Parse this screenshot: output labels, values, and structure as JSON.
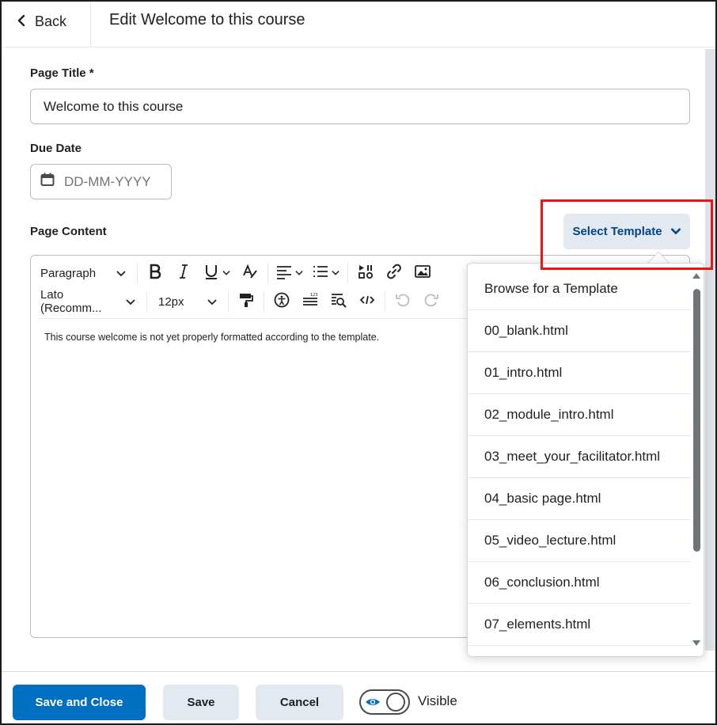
{
  "header": {
    "back_label": "Back",
    "title": "Edit Welcome to this course"
  },
  "form": {
    "page_title_label": "Page Title *",
    "page_title_value": "Welcome to this course",
    "due_date_label": "Due Date",
    "due_date_placeholder": "DD-MM-YYYY",
    "page_content_label": "Page Content"
  },
  "select_template": {
    "label": "Select Template"
  },
  "toolbar": {
    "block_format": "Paragraph",
    "font_family": "Lato (Recomm...",
    "font_size": "12px"
  },
  "editor": {
    "content": "This course welcome is not yet properly formatted according to the template."
  },
  "template_dropdown": {
    "items": [
      "Browse for a Template",
      "00_blank.html",
      "01_intro.html",
      "02_module_intro.html",
      "03_meet_your_facilitator.html",
      "04_basic page.html",
      "05_video_lecture.html",
      "06_conclusion.html",
      "07_elements.html"
    ]
  },
  "footer": {
    "save_close_label": "Save and Close",
    "save_label": "Save",
    "cancel_label": "Cancel",
    "visibility_label": "Visible"
  },
  "colors": {
    "primary": "#006fbf",
    "template_text": "#004489",
    "highlight": "#e8161b"
  }
}
